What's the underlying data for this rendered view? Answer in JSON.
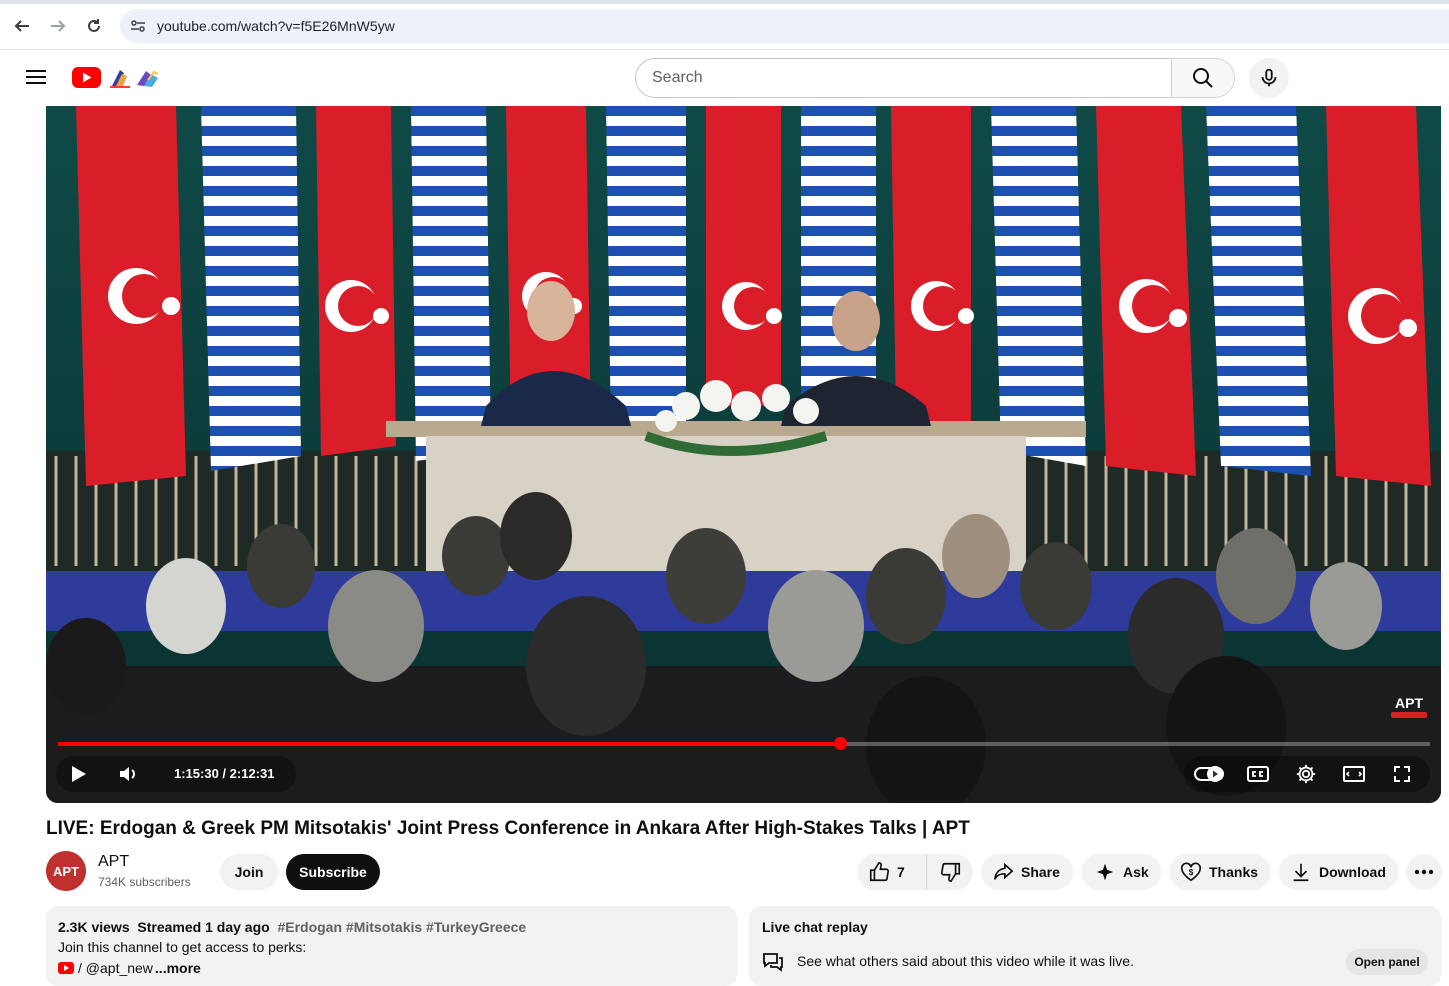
{
  "browser": {
    "url": "youtube.com/watch?v=f5E26MnW5yw"
  },
  "header": {
    "search_placeholder": "Search"
  },
  "player": {
    "current_time": "1:15:30",
    "duration": "2:12:31",
    "time_separator": " / ",
    "progress_fraction": 0.57,
    "watermark": "APT"
  },
  "video": {
    "title": "LIVE: Erdogan & Greek PM Mitsotakis' Joint Press Conference in Ankara After High-Stakes Talks | APT"
  },
  "channel": {
    "avatar_text": "APT",
    "name": "APT",
    "subscribers": "734K subscribers",
    "join_label": "Join",
    "subscribe_label": "Subscribe"
  },
  "actions": {
    "like_count": "7",
    "share_label": "Share",
    "ask_label": "Ask",
    "thanks_label": "Thanks",
    "download_label": "Download"
  },
  "description": {
    "views": "2.3K views",
    "streamed": "Streamed 1 day ago",
    "hashtags": "#Erdogan #Mitsotakis #TurkeyGreece",
    "line2": "Join this channel to get access to perks:",
    "link_prefix": "/ @apt_new",
    "more_label": "...more"
  },
  "chat": {
    "title": "Live chat replay",
    "description": "See what others said about this video while it was live.",
    "open_panel_label": "Open panel"
  },
  "colors": {
    "accent_red": "#ff0000",
    "brand_red": "#ff0000",
    "subscribe_bg": "#0f0f0f",
    "pill_bg": "#f2f2f2"
  }
}
